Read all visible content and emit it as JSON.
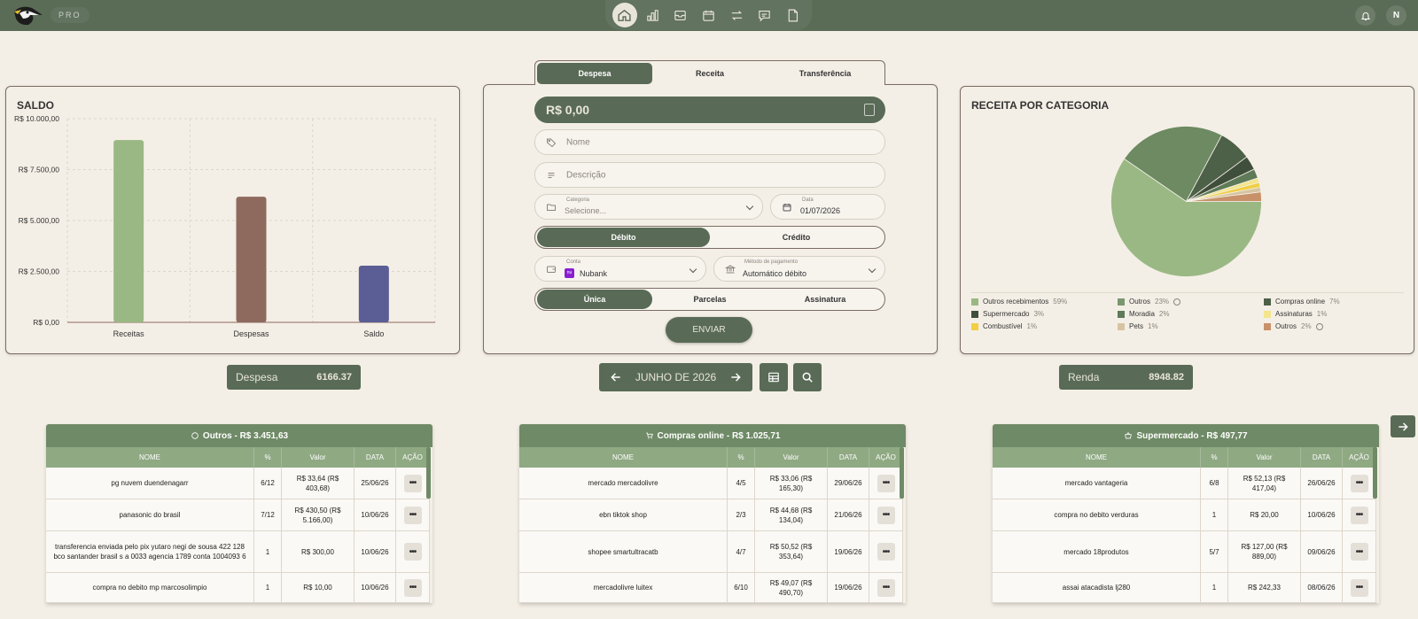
{
  "header": {
    "badge": "PRO",
    "nav_items": [
      "home-icon",
      "chart-icon",
      "inbox-icon",
      "calendar-icon",
      "transfer-icon",
      "chat-icon",
      "csv-icon"
    ],
    "avatar_initial": "N"
  },
  "saldo": {
    "title": "SALDO",
    "chart_data": {
      "type": "bar",
      "categories": [
        "Receitas",
        "Despesas",
        "Saldo"
      ],
      "values": [
        8948.82,
        6166.37,
        2782.45
      ],
      "colors": [
        "#9ab884",
        "#8e6a5e",
        "#5a5e95"
      ],
      "ylim": [
        0,
        10000
      ],
      "yticks": [
        "R$ 0,00",
        "R$ 2.500,00",
        "R$ 5.000,00",
        "R$ 7.500,00",
        "R$ 10.000,00"
      ],
      "grid": true
    }
  },
  "form": {
    "tabs": [
      "Despesa",
      "Receita",
      "Transferência"
    ],
    "amount": "R$ 0,00",
    "nome_placeholder": "Nome",
    "descricao_placeholder": "Descrição",
    "categoria_label": "Categoria",
    "categoria_placeholder": "Selecione...",
    "data_label": "Data",
    "data_value": "01/07/2026",
    "payment_types": [
      "Débito",
      "Crédito"
    ],
    "conta_label": "Conta",
    "conta_value": "Nubank",
    "conta_icon_text": "nu",
    "metodo_label": "Método de pagamento",
    "metodo_value": "Automático débito",
    "recurrence": [
      "Única",
      "Parcelas",
      "Assinatura"
    ],
    "submit": "ENVIAR"
  },
  "receita": {
    "title": "RECEITA POR CATEGORIA",
    "chart_data": {
      "type": "pie",
      "slices": [
        {
          "label": "Outros recebimentos",
          "pct": 59,
          "color": "#9ab884"
        },
        {
          "label": "Outros",
          "pct": 23,
          "color": "#6d8a62"
        },
        {
          "label": "Compras online",
          "pct": 7,
          "color": "#4d6048"
        },
        {
          "label": "Supermercado",
          "pct": 3,
          "color": "#3f4f3b"
        },
        {
          "label": "Moradia",
          "pct": 2,
          "color": "#5e7a58"
        },
        {
          "label": "Assinaturas",
          "pct": 1,
          "color": "#f3e58c"
        },
        {
          "label": "Combustível",
          "pct": 1,
          "color": "#f0cf45"
        },
        {
          "label": "Pets",
          "pct": 1,
          "color": "#d6c5a2"
        },
        {
          "label": "Outros",
          "pct": 2,
          "color": "#c8916a"
        }
      ]
    },
    "legend": [
      {
        "label": "Outros recebimentos",
        "pct": "59%",
        "color": "#9ab884",
        "info": false
      },
      {
        "label": "Outros",
        "pct": "23%",
        "color": "#7b9770",
        "info": true
      },
      {
        "label": "Compras online",
        "pct": "7%",
        "color": "#4d6048",
        "info": false
      },
      {
        "label": "Supermercado",
        "pct": "3%",
        "color": "#3f4f3b",
        "info": false
      },
      {
        "label": "Moradia",
        "pct": "2%",
        "color": "#5e7a58",
        "info": false
      },
      {
        "label": "Assinaturas",
        "pct": "1%",
        "color": "#f3e58c",
        "info": false
      },
      {
        "label": "Combustível",
        "pct": "1%",
        "color": "#f0cf45",
        "info": false
      },
      {
        "label": "Pets",
        "pct": "1%",
        "color": "#d6c5a2",
        "info": false
      },
      {
        "label": "Outros",
        "pct": "2%",
        "color": "#c8916a",
        "info": true
      }
    ]
  },
  "summary": {
    "despesa_label": "Despesa",
    "despesa_value": "6166.37",
    "month": "JUNHO DE 2026",
    "renda_label": "Renda",
    "renda_value": "8948.82"
  },
  "tables": [
    {
      "title": "Outros - R$ 3.451,63",
      "icon": "circle-icon",
      "headers": [
        "NOME",
        "%",
        "Valor",
        "DATA",
        "AÇÃO"
      ],
      "rows": [
        [
          "pg nuvem duendenagarr",
          "6/12",
          "R$ 33,64 (R$ 403,68)",
          "25/06/26"
        ],
        [
          "panasonic do brasil",
          "7/12",
          "R$ 430,50 (R$ 5.166,00)",
          "10/06/26"
        ],
        [
          "transferencia enviada pelo pix yutaro negi de sousa 422 128 bco santander brasil s a 0033 agencia 1789 conta 1004093 6",
          "1",
          "R$ 300,00",
          "10/06/26"
        ],
        [
          "compra no debito mp marcosolimpio",
          "1",
          "R$ 10,00",
          "10/06/26"
        ]
      ]
    },
    {
      "title": "Compras online - R$ 1.025,71",
      "icon": "cart-icon",
      "headers": [
        "NOME",
        "%",
        "Valor",
        "DATA",
        "AÇÃO"
      ],
      "rows": [
        [
          "mercado mercadolivre",
          "4/5",
          "R$ 33,06 (R$ 165,30)",
          "29/06/26"
        ],
        [
          "ebn tiktok shop",
          "2/3",
          "R$ 44,68 (R$ 134,04)",
          "21/06/26"
        ],
        [
          "shopee smartultracatb",
          "4/7",
          "R$ 50,52 (R$ 353,64)",
          "19/06/26"
        ],
        [
          "mercadolivre luitex",
          "6/10",
          "R$ 49,07 (R$ 490,70)",
          "19/06/26"
        ]
      ]
    },
    {
      "title": "Supermercado - R$ 497,77",
      "icon": "basket-icon",
      "headers": [
        "NOME",
        "%",
        "Valor",
        "DATA",
        "AÇÃO"
      ],
      "rows": [
        [
          "mercado vantageria",
          "6/8",
          "R$ 52,13 (R$ 417,04)",
          "26/06/26"
        ],
        [
          "compra no debito verduras",
          "1",
          "R$ 20,00",
          "10/06/26"
        ],
        [
          "mercado 18produtos",
          "5/7",
          "R$ 127,00 (R$ 889,00)",
          "09/06/26"
        ],
        [
          "assai atacadista lj280",
          "1",
          "R$ 242,33",
          "08/06/26"
        ]
      ]
    }
  ]
}
